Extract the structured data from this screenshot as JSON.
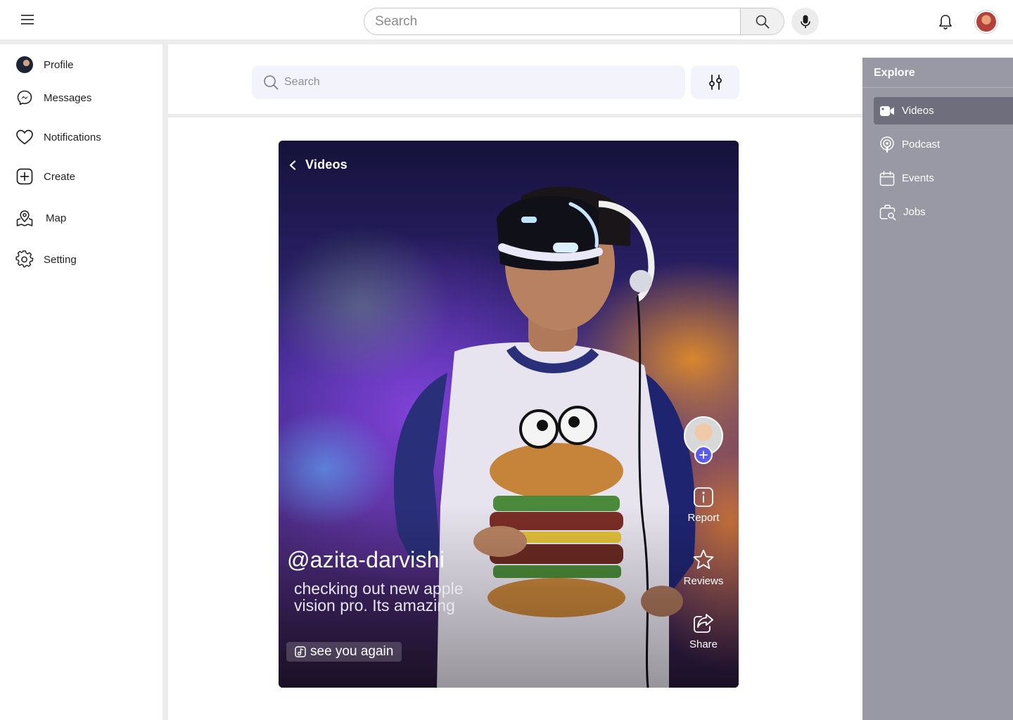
{
  "topbar": {
    "search_placeholder": "Search"
  },
  "sidebar": {
    "items": [
      {
        "label": "Profile",
        "icon": "profile-avatar"
      },
      {
        "label": "Messages",
        "icon": "messenger-icon"
      },
      {
        "label": "Notifications",
        "icon": "heart-icon"
      },
      {
        "label": "Create",
        "icon": "plus-square-icon"
      },
      {
        "label": "Map",
        "icon": "map-pin-icon"
      },
      {
        "label": "Setting",
        "icon": "gear-icon"
      }
    ]
  },
  "main": {
    "search_placeholder": "Search"
  },
  "video": {
    "back_label": "Videos",
    "handle": "@azita-darvishi",
    "caption": "checking out new apple vision pro. Its amazing",
    "sound": "see you again",
    "actions": [
      {
        "label": "Report",
        "icon": "info-icon"
      },
      {
        "label": "Reviews",
        "icon": "star-icon"
      },
      {
        "label": "Share",
        "icon": "share-icon"
      }
    ]
  },
  "explore": {
    "title": "Explore",
    "items": [
      {
        "label": "Videos",
        "icon": "video-camera-icon",
        "active": true
      },
      {
        "label": "Podcast",
        "icon": "podcast-icon",
        "active": false
      },
      {
        "label": "Events",
        "icon": "calendar-icon",
        "active": false
      },
      {
        "label": "Jobs",
        "icon": "briefcase-search-icon",
        "active": false
      }
    ]
  },
  "colors": {
    "accent": "#5b5bf0",
    "explore_panel": "#9999a5",
    "explore_active": "#6e6e7c",
    "search_bg": "#f2f3fb"
  }
}
